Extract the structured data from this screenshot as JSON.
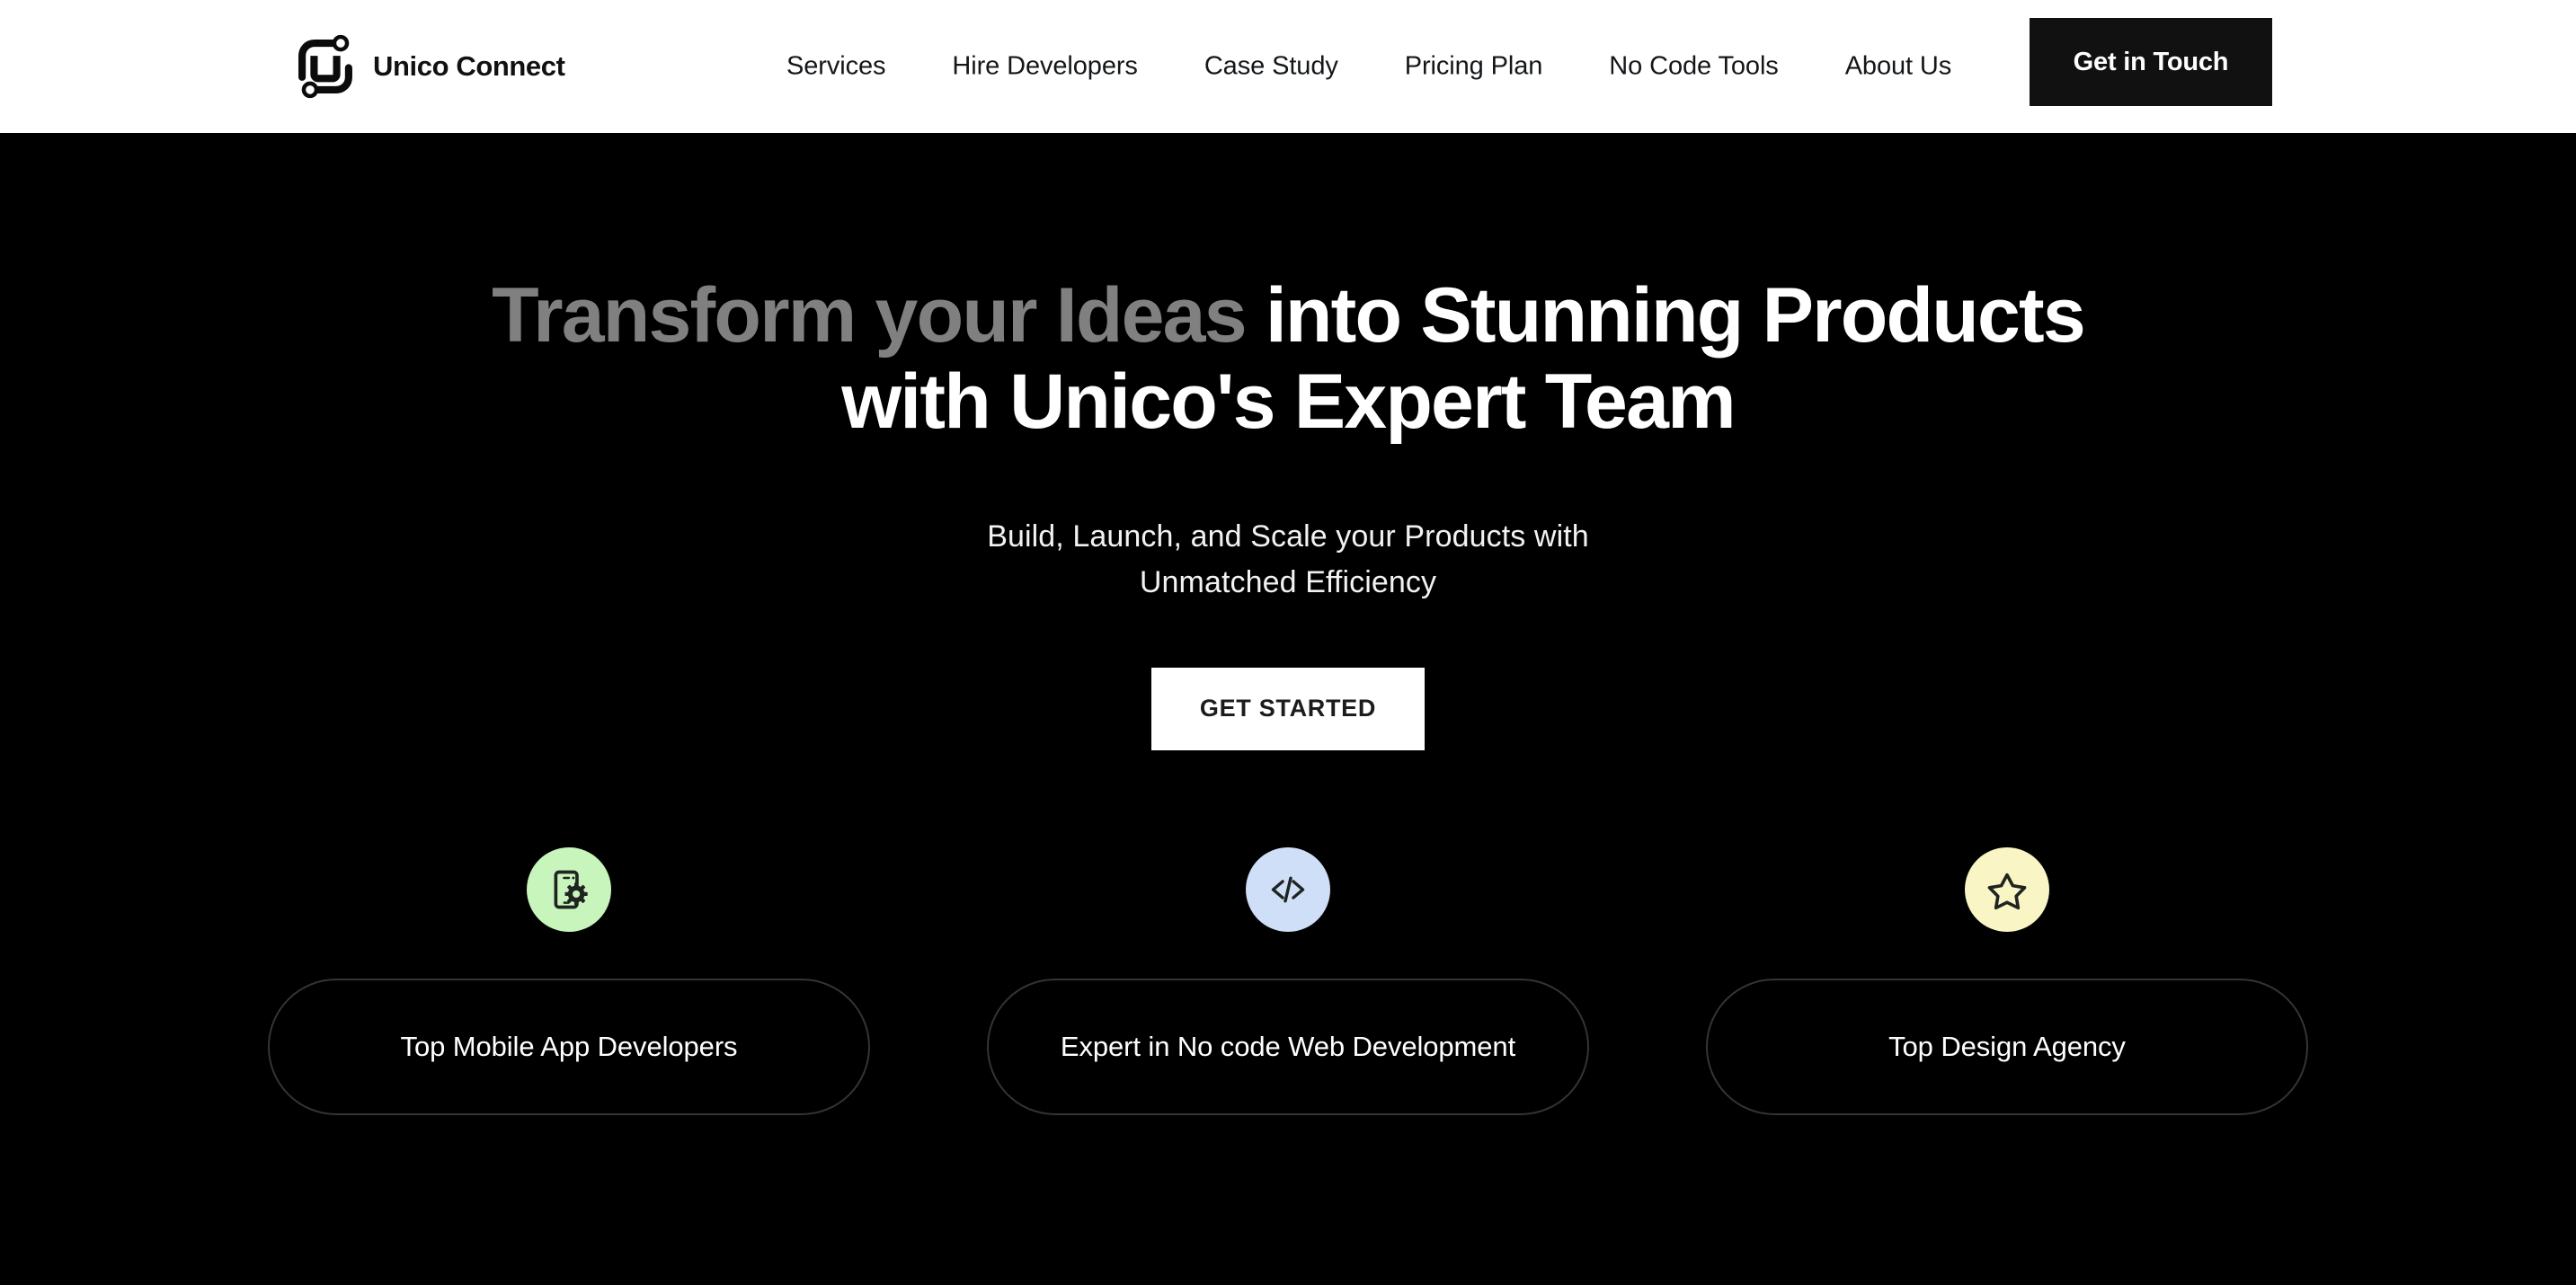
{
  "header": {
    "brand": {
      "name": "Unico Connect",
      "logo_icon": "unico-connect-logo"
    },
    "nav_items": [
      {
        "label": "Services"
      },
      {
        "label": "Hire Developers"
      },
      {
        "label": "Case Study"
      },
      {
        "label": "Pricing Plan"
      },
      {
        "label": "No Code Tools"
      },
      {
        "label": "About Us"
      }
    ],
    "cta": {
      "label": "Get in Touch",
      "background": "#111111",
      "text_color": "#ffffff"
    },
    "background": "#ffffff"
  },
  "hero": {
    "background": "#000000",
    "headline": {
      "muted_part": "Transform your Ideas",
      "muted_color": "#808080",
      "bright_part": " into Stunning Products with Unico's Expert Team",
      "bright_color": "#ffffff"
    },
    "subtitle_line_1": "Build, Launch, and Scale your Products with",
    "subtitle_line_2": "Unmatched Efficiency",
    "cta": {
      "label": "GET STARTED",
      "background": "#ffffff",
      "text_color": "#1c1c1c"
    },
    "badges": [
      {
        "label": "Top Mobile App Developers",
        "icon": "mobile-gear-icon",
        "circle_color": "#c8f5bc",
        "glyph_color": "#1f2421"
      },
      {
        "label": "Expert in No code Web Development",
        "icon": "code-brackets-icon",
        "circle_color": "#cfdff7",
        "glyph_color": "#1f2421"
      },
      {
        "label": "Top Design Agency",
        "icon": "star-outline-icon",
        "circle_color": "#faf5c4",
        "glyph_color": "#1f2421"
      }
    ],
    "badge_pill_border": "#343434"
  }
}
